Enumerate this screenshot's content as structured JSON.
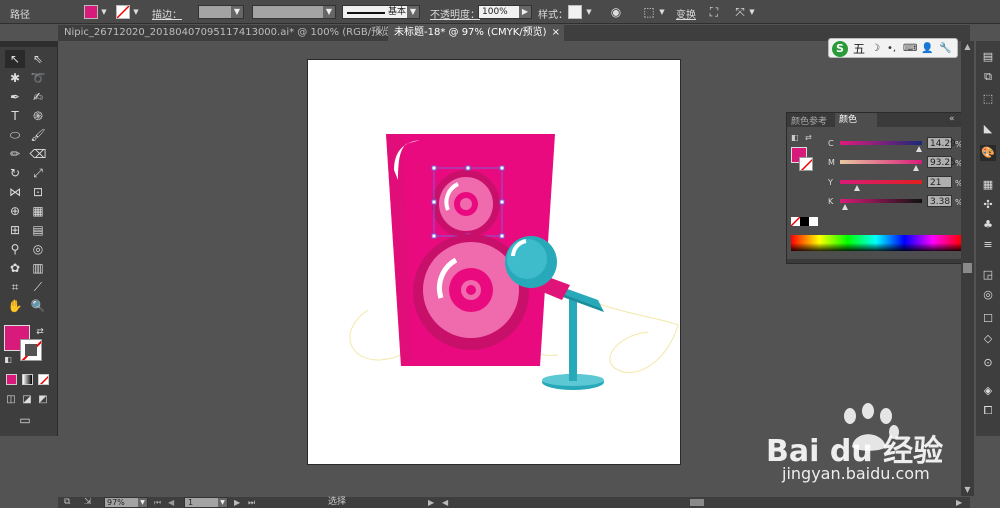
{
  "control_bar": {
    "object_type": "路径",
    "fill_color": "#d81b7a",
    "stroke_label": "描边：",
    "stroke_style": "基本",
    "opacity_label": "不透明度：",
    "opacity_value": "100%",
    "style_label": "样式：",
    "transform_label": "变换"
  },
  "tabs": [
    {
      "title": "Nipic_26712020_20180407095117413000.ai* @ 100% (RGB/预览)",
      "close": "×"
    },
    {
      "title": "未标题-18* @ 97% (CMYK/预览)",
      "close": "×"
    }
  ],
  "color_panel": {
    "tab_guide": "颜色参考",
    "tab_color": "颜色",
    "fill": "#d81b7a",
    "sliders": [
      {
        "label": "C",
        "value": "14.29",
        "pct": "%",
        "level": 0.97
      },
      {
        "label": "M",
        "value": "93.25",
        "pct": "%",
        "level": 0.92
      },
      {
        "label": "Y",
        "value": "21",
        "pct": "%",
        "level": 0.21
      },
      {
        "label": "K",
        "value": "3.38",
        "pct": "%",
        "level": 0.03
      }
    ]
  },
  "ime_toolbar": {
    "logo": "S",
    "label": "五"
  },
  "status_bar": {
    "zoom": "97%",
    "page": "1",
    "mode": "选择"
  },
  "watermark": {
    "brand": "Bai du 经验",
    "url": "jingyan.baidu.com"
  },
  "colors": {
    "speaker_pink": "#ea0a7f",
    "speaker_dark": "#c8106b",
    "cone_light": "#f06aae",
    "mic_teal": "#27a9b9",
    "mic_pink": "#e01478"
  }
}
